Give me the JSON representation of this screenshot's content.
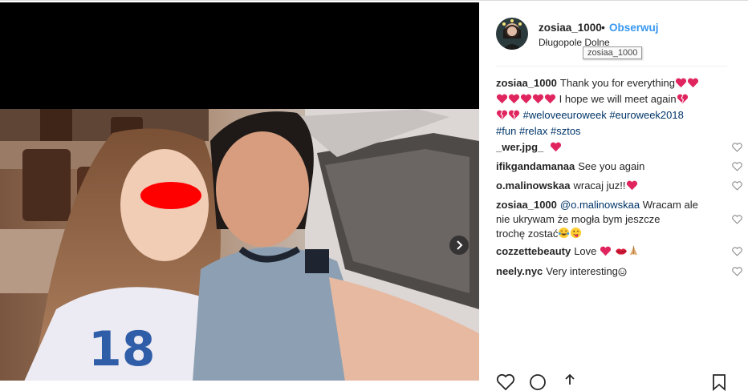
{
  "post": {
    "username": "zosiaa_1000",
    "separator": "•",
    "follow_label": "Obserwuj",
    "location": "Długopole Dolne",
    "tooltip": "zosiaa_1000"
  },
  "caption": {
    "author": "zosiaa_1000",
    "line1": "Thank you for everything",
    "line2_text": " I hope we will meet again",
    "tags": [
      "#weloveeuroweek",
      "#euroweek2018",
      "#fun",
      "#relax",
      "#sztos"
    ]
  },
  "comments": [
    {
      "author": "_wer.jpg_",
      "text": ""
    },
    {
      "author": "ifikgandamanaa",
      "text": "See you again"
    },
    {
      "author": "o.malinowskaa",
      "text": "wracaj juz!!"
    },
    {
      "author": "zosiaa_1000",
      "mention": "@o.malinowskaa",
      "line1": " Wracam ale",
      "line2": "nie ukrywam że mogła bym jeszcze",
      "line3": "trochę zostać"
    },
    {
      "author": "cozzettebeauty",
      "text": "Love"
    },
    {
      "author": "neely.nyc",
      "text": "Very interesting"
    }
  ],
  "icons": {
    "next": "chevron-right-icon",
    "like": "heart-outline-icon",
    "comment": "speech-bubble-icon",
    "share": "share-icon",
    "save": "bookmark-icon",
    "emoji_heart": "red-heart-emoji",
    "emoji_broken": "broken-heart-emoji",
    "emoji_tears": "tears-of-joy-emoji",
    "emoji_tongue": "winking-tongue-emoji",
    "emoji_lips": "kiss-lips-emoji",
    "emoji_pray": "praying-hands-emoji",
    "emoji_smile": "smile-emoji"
  },
  "colors": {
    "link": "#003569",
    "follow": "#3897f0",
    "heart": "#ed4956",
    "text": "#262626"
  }
}
